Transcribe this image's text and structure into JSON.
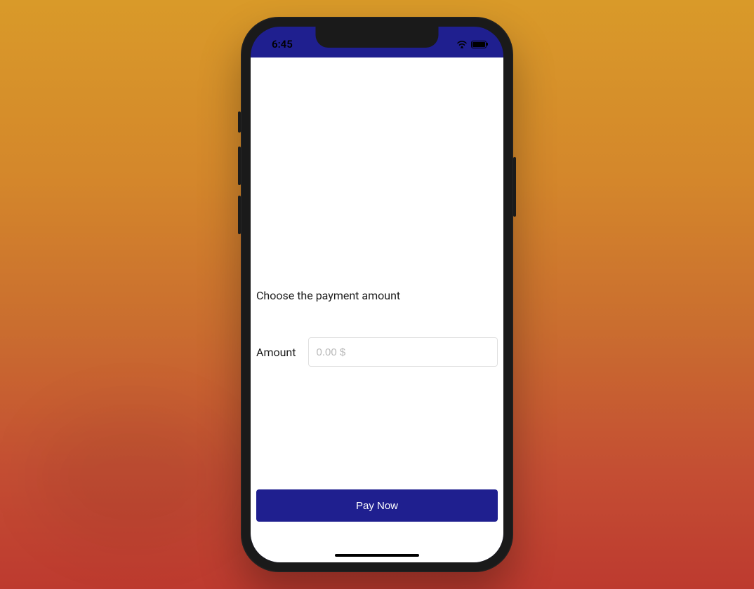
{
  "status": {
    "time": "6:45"
  },
  "payment": {
    "choose_text": "Choose the payment amount",
    "amount_label": "Amount",
    "amount_placeholder": "0.00 $",
    "amount_value": ""
  },
  "actions": {
    "pay_button_label": "Pay Now"
  }
}
